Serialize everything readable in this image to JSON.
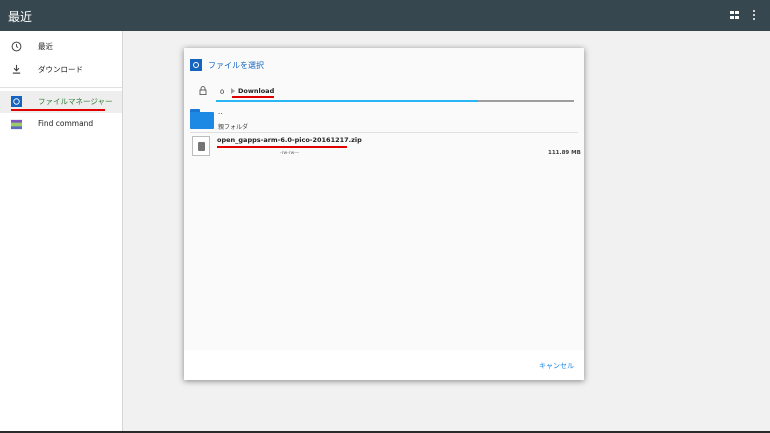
{
  "app_bar": {
    "title": "最近",
    "grid_icon": "grid-view-icon",
    "menu_icon": "more-vert-icon"
  },
  "sidebar": {
    "items": [
      {
        "label": "最近",
        "icon": "clock-icon"
      },
      {
        "label": "ダウンロード",
        "icon": "download-icon"
      },
      {
        "label": "ファイルマネージャー",
        "icon": "file-manager-app-icon"
      },
      {
        "label": "Find command",
        "icon": "terminal-icon"
      }
    ]
  },
  "dialog": {
    "title": "ファイルを選択",
    "path": {
      "root": "0",
      "current": "Download"
    },
    "parent_entry": {
      "name": "..",
      "label": "親フォルダ"
    },
    "file_entry": {
      "name": "open_gapps-arm-6.0-pico-20161217.zip",
      "permissions": "-rw-rw---",
      "size": "111.89 MB"
    },
    "cancel_label": "キャンセル"
  },
  "colors": {
    "app_bar": "#37474f",
    "accent": "#1e88e5",
    "highlight": "#e00000",
    "progress": "#29b6f6"
  }
}
